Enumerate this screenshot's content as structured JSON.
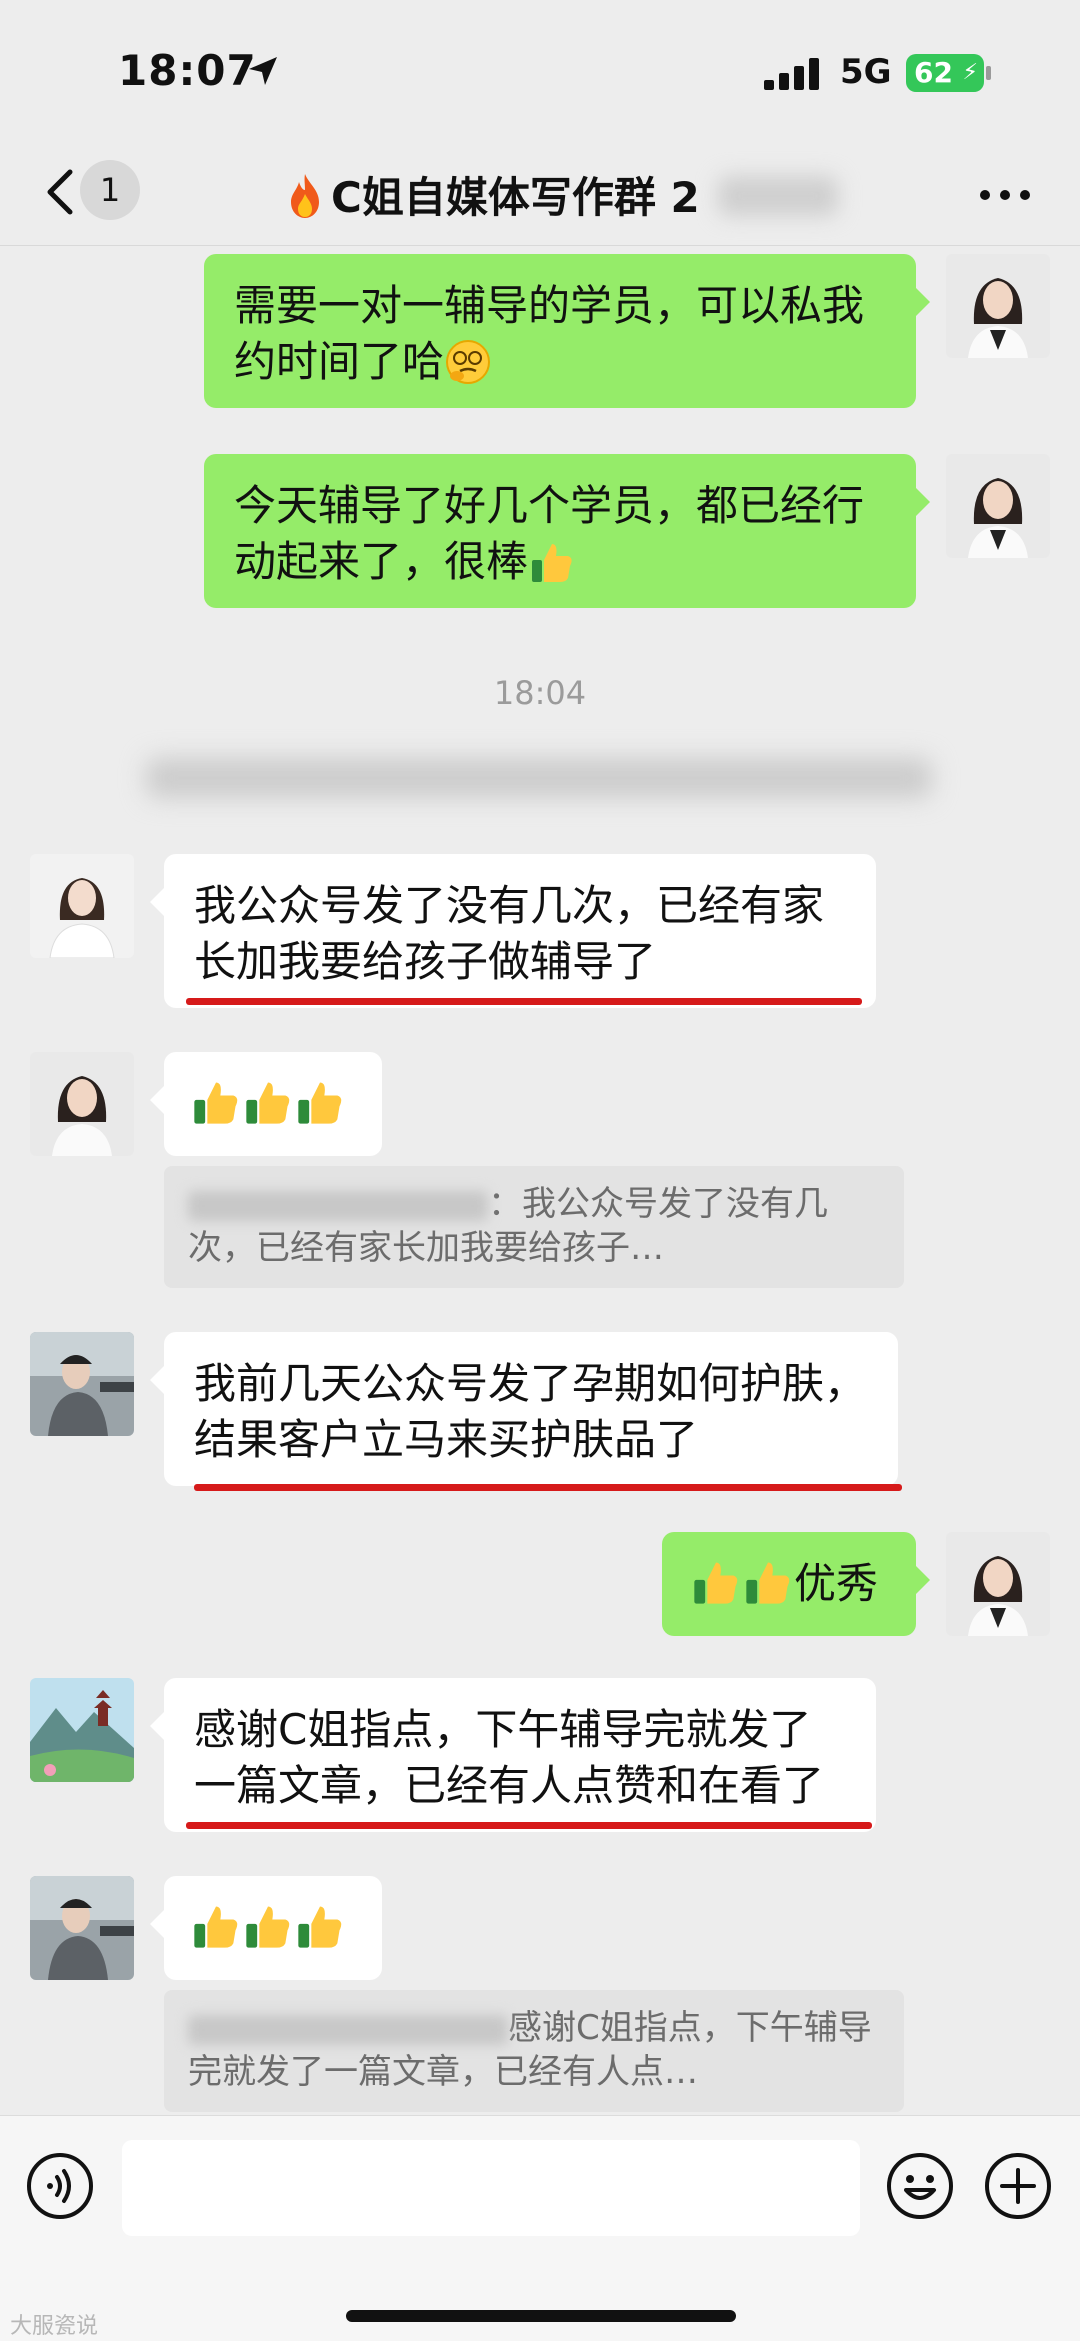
{
  "status_bar": {
    "time": "18:07",
    "network": "5G",
    "battery": "62"
  },
  "nav": {
    "unread_count": "1",
    "title": "C姐自媒体写作群 2"
  },
  "messages": [
    {
      "id": "m1",
      "side": "right",
      "text": "需要一对一辅导的学员，可以私我约时间了哈",
      "emoji": "thinking-face"
    },
    {
      "id": "m2",
      "side": "right",
      "text": "今天辅导了好几个学员，都已经行动起来了，很棒",
      "emoji": "thumbs-up"
    },
    {
      "id": "m3",
      "side": "left",
      "text": "我公众号发了没有几次，已经有家长加我要给孩子做辅导了",
      "underlined": true
    },
    {
      "id": "m4",
      "side": "left",
      "emoji": "thumbs-up x3",
      "quote": "：我公众号发了没有几次，已经有家长加我要给孩子…"
    },
    {
      "id": "m5",
      "side": "left",
      "text": "我前几天公众号发了孕期如何护肤，结果客户立马来买护肤品了",
      "underlined": true
    },
    {
      "id": "m6",
      "side": "right",
      "text": "优秀",
      "emoji": "thumbs-up x2"
    },
    {
      "id": "m7",
      "side": "left",
      "text": "感谢C姐指点，下午辅导完就发了一篇文章，已经有人点赞和在看了",
      "underlined": true
    },
    {
      "id": "m8",
      "side": "left",
      "emoji": "thumbs-up x3",
      "quote": "感谢C姐指点，下午辅导完就发了一篇文章，已经有人点…"
    }
  ],
  "time_divider": "18:04",
  "watermark": "大服瓷说",
  "colors": {
    "green_bubble": "#95ec69",
    "background": "#ededed",
    "underline": "#d61a1a"
  }
}
